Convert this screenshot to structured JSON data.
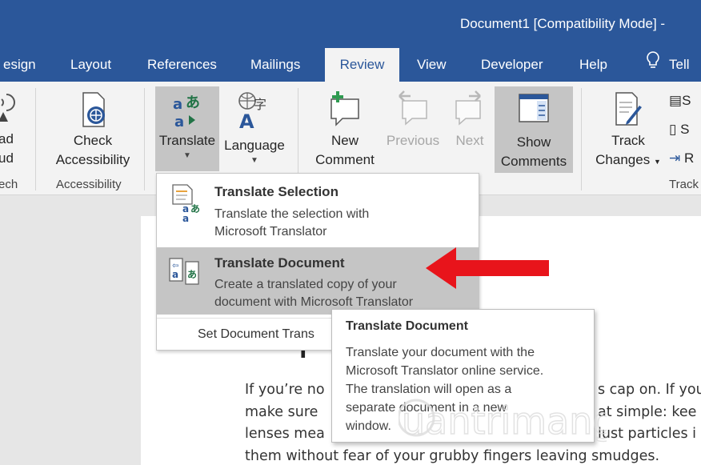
{
  "window": {
    "title": "Document1 [Compatibility Mode]  -"
  },
  "tabs": [
    {
      "label": "esign"
    },
    {
      "label": "Layout"
    },
    {
      "label": "References"
    },
    {
      "label": "Mailings"
    },
    {
      "label": "Review"
    },
    {
      "label": "View"
    },
    {
      "label": "Developer"
    },
    {
      "label": "Help"
    },
    {
      "label": "Tell"
    }
  ],
  "ribbon": {
    "read_aloud": {
      "line1": "ad",
      "line2": "ud",
      "group": "ech"
    },
    "check_accessibility": {
      "line1": "Check",
      "line2": "Accessibility",
      "group": "Accessibility"
    },
    "translate": {
      "label": "Translate"
    },
    "language": {
      "label": "Language"
    },
    "new_comment": {
      "line1": "New",
      "line2": "Comment"
    },
    "previous": {
      "label": "Previous"
    },
    "next": {
      "label": "Next"
    },
    "show_comments": {
      "line1": "Show",
      "line2": "Comments"
    },
    "track_changes": {
      "line1": "Track",
      "line2": "Changes"
    },
    "tracking_group": "Track",
    "small_r": "R",
    "small_s1": "S",
    "small_s2": "S"
  },
  "translate_menu": {
    "selection": {
      "title": "Translate Selection",
      "desc1": "Translate the selection with",
      "desc2": "Microsoft Translator"
    },
    "document": {
      "title": "Translate Document",
      "desc1": "Create a translated copy of your",
      "desc2": "document with Microsoft Translator"
    },
    "footer": "Set Document Trans"
  },
  "tooltip": {
    "title": "Translate Document",
    "lines": [
      "Translate your document with the",
      "Microsoft Translator online service.",
      "The translation will open as a",
      "separate document in a new",
      "window."
    ]
  },
  "document": {
    "title_fragment": "T",
    "lines": [
      "If you’re no",
      "make sure",
      "lenses mea",
      "them without fear of your grubby fingers leaving smudges."
    ],
    "right_fragments": [
      "s cap on. If you",
      "at simple: kee",
      "lust particles i"
    ]
  },
  "watermark": "Quantrimang",
  "colors": {
    "title_bar": "#2b579a",
    "ribbon_bg": "#f3f3f3",
    "selected_bg": "#c5c5c5",
    "arrow_red": "#e8141b"
  }
}
